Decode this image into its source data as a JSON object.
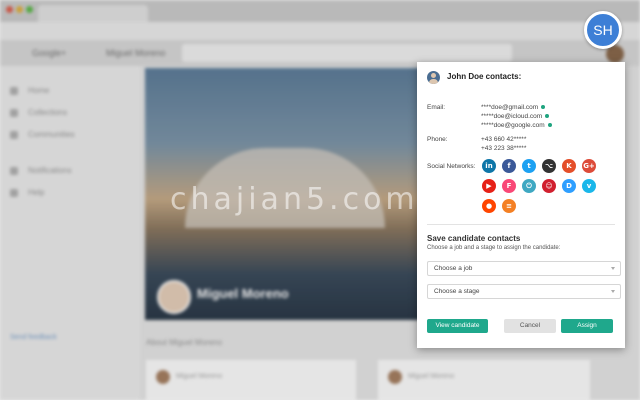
{
  "background": {
    "brand": "Google+",
    "user": "Miguel Moreno",
    "nav_items": [
      "Home",
      "Collections",
      "Communities",
      "Notifications",
      "Help"
    ],
    "nav_link": "Send feedback",
    "cover_name": "Miguel Moreno",
    "recent_label": "About Miguel Moreno",
    "card_names": [
      "Miguel Moreno",
      "Miguel Moreno"
    ]
  },
  "badge": {
    "initials": "SH"
  },
  "popup": {
    "title": "John Doe contacts:",
    "email_label": "Email:",
    "emails": [
      "****doe@gmail.com",
      "*****doe@icloud.com",
      "*****doe@google.com"
    ],
    "phone_label": "Phone:",
    "phones": [
      "+43 660 42*****",
      "+43 223 38*****"
    ],
    "social_label": "Social Networks:",
    "socials": [
      {
        "name": "linkedin-icon",
        "glyph": "in",
        "color": "#0e76a8"
      },
      {
        "name": "facebook-icon",
        "glyph": "f",
        "color": "#3b5998"
      },
      {
        "name": "twitter-icon",
        "glyph": "t",
        "color": "#1da1f2"
      },
      {
        "name": "github-icon",
        "glyph": "⌥",
        "color": "#333333"
      },
      {
        "name": "klout-icon",
        "glyph": "K",
        "color": "#e44f2a"
      },
      {
        "name": "google-plus-icon",
        "glyph": "G+",
        "color": "#dd4b39"
      },
      {
        "name": "youtube-icon",
        "glyph": "▶",
        "color": "#e62117"
      },
      {
        "name": "foursquare-icon",
        "glyph": "F",
        "color": "#f94877"
      },
      {
        "name": "power-icon",
        "glyph": "⏻",
        "color": "#3fa8c2"
      },
      {
        "name": "reddit-alien-icon",
        "glyph": "☺",
        "color": "#d1202f"
      },
      {
        "name": "disqus-icon",
        "glyph": "D",
        "color": "#2e9fff"
      },
      {
        "name": "vimeo-icon",
        "glyph": "v",
        "color": "#1ab7ea"
      },
      {
        "name": "reddit-icon",
        "glyph": "●",
        "color": "#ff4500"
      },
      {
        "name": "stackoverflow-icon",
        "glyph": "≡",
        "color": "#f48024"
      }
    ],
    "save_title": "Save candidate contacts",
    "save_subtitle": "Choose a job and a stage to assign the candidate:",
    "job_select": "Choose a job",
    "stage_select": "Choose a stage",
    "buttons": {
      "view": "View candidate",
      "cancel": "Cancel",
      "assign": "Assign"
    },
    "accent": "#1fa88c"
  },
  "watermark": "chajian5.com"
}
